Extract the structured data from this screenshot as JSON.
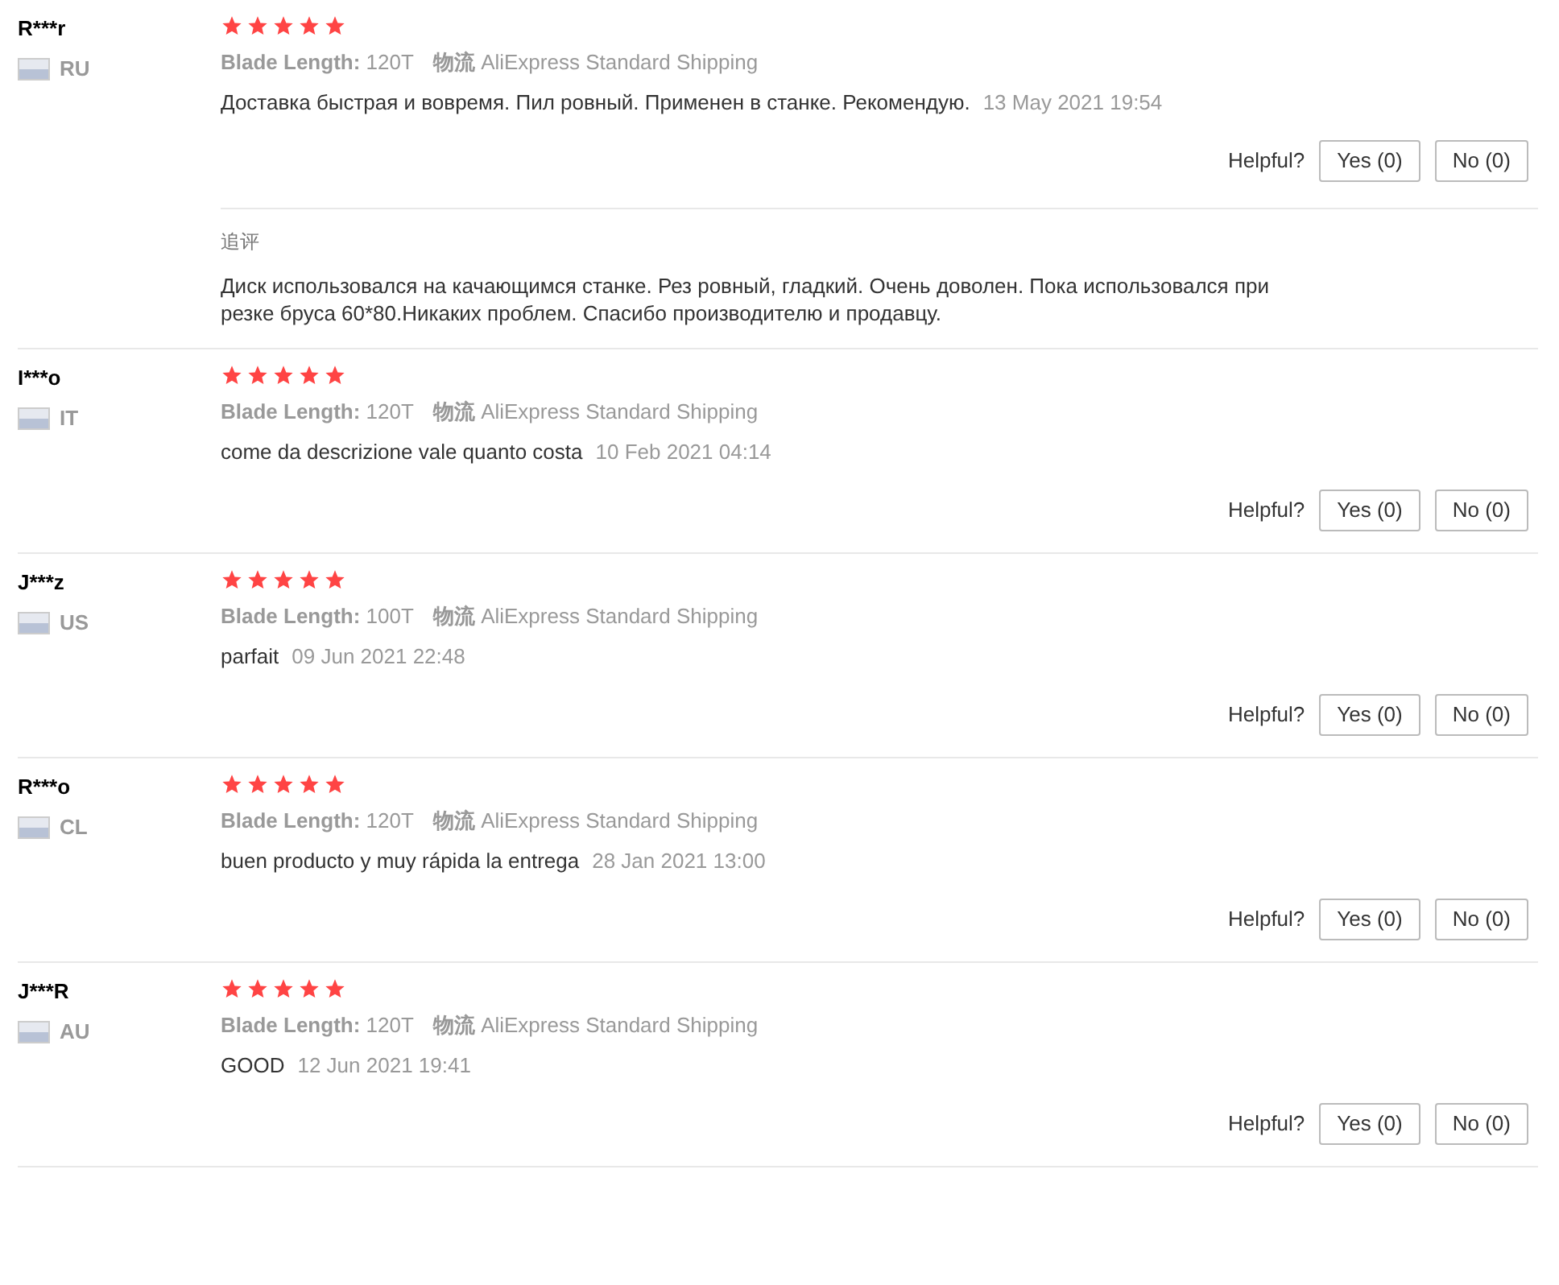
{
  "reviews": [
    {
      "user": "R***r",
      "country": "RU",
      "stars": 5,
      "attr_label": "Blade Length:",
      "attr_value": "120T",
      "shipping_label": "物流",
      "shipping_value": "AliExpress Standard Shipping",
      "text": "Доставка быстрая и вовремя. Пил ровный. Применен в станке. Рекомендую.",
      "date": "13 May 2021 19:54",
      "helpful_label": "Helpful?",
      "yes": "Yes (0)",
      "no": "No (0)",
      "followup": {
        "label": "追评",
        "text": "Диск использовался на качающимся станке. Рез ровный, гладкий. Очень доволен. Пока использовался при резке бруса 60*80.Никаких проблем. Спасибо производителю и продавцу."
      }
    },
    {
      "user": "I***o",
      "country": "IT",
      "stars": 5,
      "attr_label": "Blade Length:",
      "attr_value": "120T",
      "shipping_label": "物流",
      "shipping_value": "AliExpress Standard Shipping",
      "text": "come da descrizione vale quanto costa",
      "date": "10 Feb 2021 04:14",
      "helpful_label": "Helpful?",
      "yes": "Yes (0)",
      "no": "No (0)"
    },
    {
      "user": "J***z",
      "country": "US",
      "stars": 5,
      "attr_label": "Blade Length:",
      "attr_value": "100T",
      "shipping_label": "物流",
      "shipping_value": "AliExpress Standard Shipping",
      "text": "parfait",
      "date": "09 Jun 2021 22:48",
      "helpful_label": "Helpful?",
      "yes": "Yes (0)",
      "no": "No (0)"
    },
    {
      "user": "R***o",
      "country": "CL",
      "stars": 5,
      "attr_label": "Blade Length:",
      "attr_value": "120T",
      "shipping_label": "物流",
      "shipping_value": "AliExpress Standard Shipping",
      "text": "buen producto y muy rápida la entrega",
      "date": "28 Jan 2021 13:00",
      "helpful_label": "Helpful?",
      "yes": "Yes (0)",
      "no": "No (0)"
    },
    {
      "user": "J***R",
      "country": "AU",
      "stars": 5,
      "attr_label": "Blade Length:",
      "attr_value": "120T",
      "shipping_label": "物流",
      "shipping_value": "AliExpress Standard Shipping",
      "text": "GOOD",
      "date": "12 Jun 2021 19:41",
      "helpful_label": "Helpful?",
      "yes": "Yes (0)",
      "no": "No (0)"
    }
  ]
}
